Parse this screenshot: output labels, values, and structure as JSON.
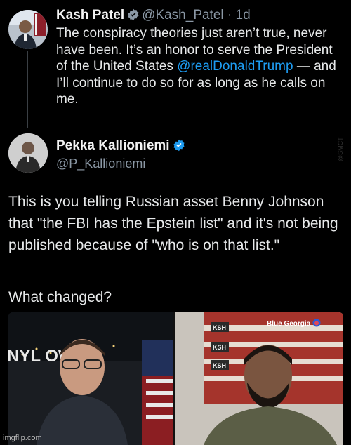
{
  "tweet1": {
    "name": "Kash Patel",
    "handle_time": "@Kash_Patel · 1d",
    "text_before": "The conspiracy theories just aren’t true, never have been. It’s an honor to serve the President of the United States ",
    "mention": "@realDonaldTrump",
    "text_after": " — and I’ll continue to do so for as long as he calls on me."
  },
  "tweet2": {
    "name": "Pekka Kallioniemi",
    "handle": "@P_Kallioniemi",
    "text": "This is you telling Russian asset Benny Johnson that \"the FBI has the Epstein list\" and it's not being published because of \"who is on that list.\"",
    "question": "What changed?"
  },
  "media": {
    "overlay_label": "Blue Georgia",
    "left_sign_text": "NYL OW",
    "right_sign_tags": [
      "KSH",
      "KSH",
      "KSH"
    ]
  },
  "watermarks": {
    "side": "@SMCT",
    "footer": "imgflip.com"
  },
  "colors": {
    "background": "#000000",
    "text": "#e7e9ea",
    "secondary": "#8b98a5",
    "link": "#1d9bf0",
    "verified_badge": "#1d9bf0"
  }
}
